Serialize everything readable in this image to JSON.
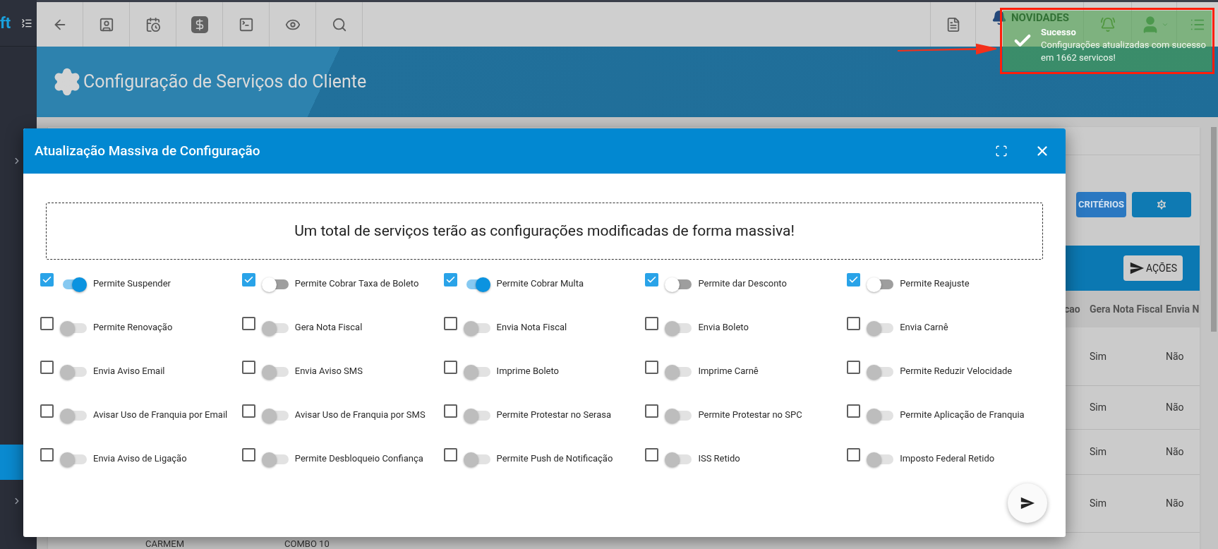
{
  "sidebar": {
    "logo": "ft",
    "items": [
      {
        "kind": "chevron"
      },
      {
        "kind": "block",
        "selected": true
      },
      {
        "kind": "chevron"
      }
    ]
  },
  "toolbar": {
    "right": {
      "news_label": "NOVIDADES"
    }
  },
  "page": {
    "title": "Configuração de Serviços do Cliente"
  },
  "background": {
    "criteria_button": "CRITÉRIOS",
    "actions_button": "AÇÕES",
    "table": {
      "columns": [
        "cao",
        "Gera Nota Fiscal",
        "Envia N"
      ],
      "rows": [
        {
          "cells": [
            "",
            "Sim",
            "Não"
          ]
        },
        {
          "cells": [
            "",
            "Sim",
            "Não"
          ]
        },
        {
          "cells": [
            "",
            "Sim",
            "Não"
          ]
        },
        {
          "cells": [
            "",
            "Sim",
            "Não"
          ]
        }
      ],
      "last_row": [
        "CARMEM",
        "COMBO 10"
      ]
    }
  },
  "modal": {
    "title": "Atualização Massiva de Configuração",
    "notice": "Um total de serviços terão as configurações modificadas de forma massiva!",
    "options": [
      {
        "label": "Permite Suspender",
        "checked": true,
        "on": true
      },
      {
        "label": "Permite Cobrar Taxa de Boleto",
        "checked": true,
        "on": false
      },
      {
        "label": "Permite Cobrar Multa",
        "checked": true,
        "on": true
      },
      {
        "label": "Permite dar Desconto",
        "checked": true,
        "on": false
      },
      {
        "label": "Permite Reajuste",
        "checked": true,
        "on": false
      },
      {
        "label": "Permite Renovação",
        "checked": false,
        "on": false
      },
      {
        "label": "Gera Nota Fiscal",
        "checked": false,
        "on": false
      },
      {
        "label": "Envia Nota Fiscal",
        "checked": false,
        "on": false
      },
      {
        "label": "Envia Boleto",
        "checked": false,
        "on": false
      },
      {
        "label": "Envia Carnê",
        "checked": false,
        "on": false
      },
      {
        "label": "Envia Aviso Email",
        "checked": false,
        "on": false
      },
      {
        "label": "Envia Aviso SMS",
        "checked": false,
        "on": false
      },
      {
        "label": "Imprime Boleto",
        "checked": false,
        "on": false
      },
      {
        "label": "Imprime Carnê",
        "checked": false,
        "on": false
      },
      {
        "label": "Permite Reduzir Velocidade",
        "checked": false,
        "on": false
      },
      {
        "label": "Avisar Uso de Franquia por Email",
        "checked": false,
        "on": false
      },
      {
        "label": "Avisar Uso de Franquia por SMS",
        "checked": false,
        "on": false
      },
      {
        "label": "Permite Protestar no Serasa",
        "checked": false,
        "on": false
      },
      {
        "label": "Permite Protestar no SPC",
        "checked": false,
        "on": false
      },
      {
        "label": "Permite Aplicação de Franquia",
        "checked": false,
        "on": false
      },
      {
        "label": "Envia Aviso de Ligação",
        "checked": false,
        "on": false
      },
      {
        "label": "Permite Desbloqueio Confiança",
        "checked": false,
        "on": false
      },
      {
        "label": "Permite Push de Notificação",
        "checked": false,
        "on": false
      },
      {
        "label": "ISS Retido",
        "checked": false,
        "on": false
      },
      {
        "label": "Imposto Federal Retido",
        "checked": false,
        "on": false
      }
    ]
  },
  "toast": {
    "title": "Sucesso",
    "message": "Configurações atualizadas com sucesso em 1662 servicos!"
  }
}
